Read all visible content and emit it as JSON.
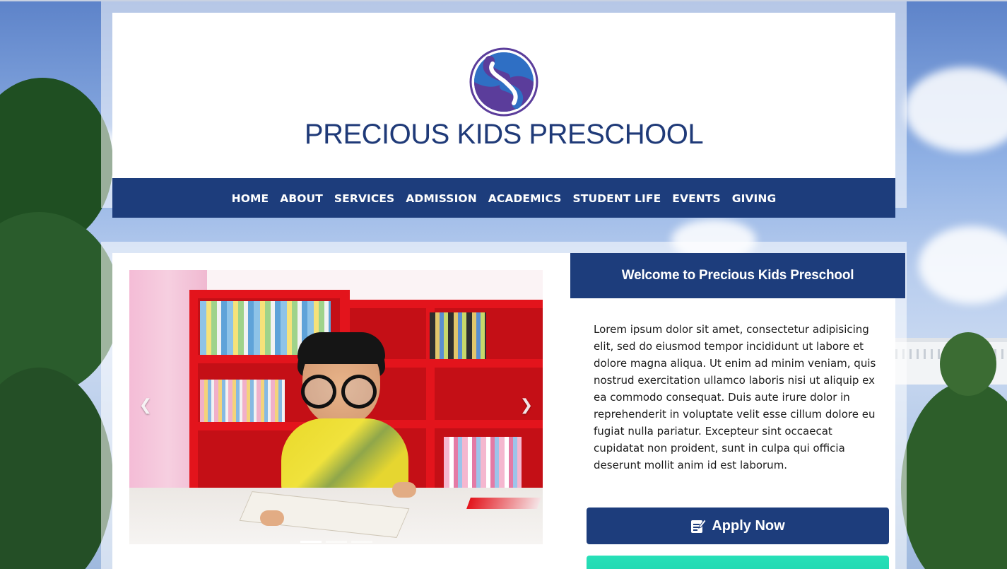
{
  "header": {
    "school_name": "PRECIOUS KIDS PRESCHOOL"
  },
  "nav": {
    "items": [
      {
        "label": "HOME"
      },
      {
        "label": "ABOUT"
      },
      {
        "label": "SERVICES"
      },
      {
        "label": "ADMISSION"
      },
      {
        "label": "ACADEMICS"
      },
      {
        "label": "STUDENT LIFE"
      },
      {
        "label": "EVENTS"
      },
      {
        "label": "GIVING"
      }
    ]
  },
  "carousel": {
    "prev_icon": "chevron-left-icon",
    "next_icon": "chevron-right-icon",
    "slide_count": 3,
    "active_slide": 1
  },
  "welcome": {
    "title": "Welcome to Precious Kids Preschool",
    "body": "Lorem ipsum dolor sit amet, consectetur adipisicing elit, sed do eiusmod tempor incididunt ut labore et dolore magna aliqua. Ut enim ad minim veniam, quis nostrud exercitation ullamco laboris nisi ut aliquip ex ea commodo consequat. Duis aute irure dolor in reprehenderit in voluptate velit esse cillum dolore eu fugiat nulla pariatur. Excepteur sint occaecat cupidatat non proident, sunt in culpa qui officia deserunt mollit anim id est laborum."
  },
  "actions": {
    "apply_label": "Apply Now",
    "apply_icon": "edit-icon"
  },
  "colors": {
    "brand_navy": "#1d3d7c",
    "title_blue": "#1f3a78",
    "accent_teal": "#1ed0aa",
    "logo_purple": "#5b3d9b",
    "logo_blue": "#2f6fc4"
  }
}
